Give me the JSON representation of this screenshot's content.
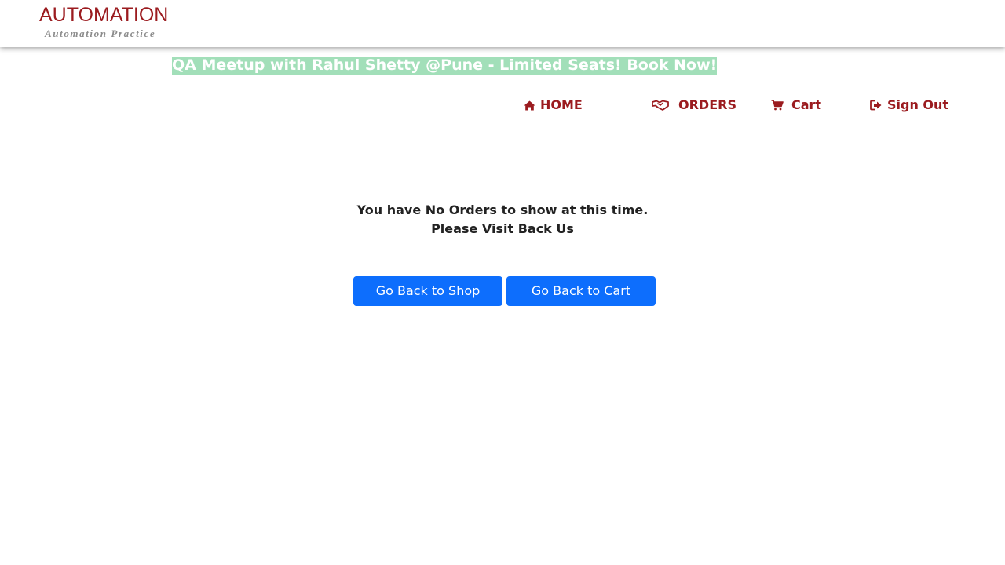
{
  "header": {
    "logo_title": "AUTOMATION",
    "logo_subtitle": "Automation Practice"
  },
  "banner": {
    "text": "QA Meetup with Rahul Shetty @Pune - Limited Seats! Book Now!"
  },
  "nav": {
    "items": [
      {
        "label": "HOME",
        "icon": "home-icon"
      },
      {
        "label": "ORDERS",
        "icon": "handshake-icon"
      },
      {
        "label": "Cart",
        "icon": "shopping-cart-icon"
      },
      {
        "label": "Sign Out",
        "icon": "sign-out-icon"
      }
    ]
  },
  "main": {
    "message_line1": "You have No Orders to show at this time.",
    "message_line2": "Please Visit Back Us",
    "shop_button_label": "Go Back to Shop",
    "cart_button_label": "Go Back to Cart"
  },
  "colors": {
    "brand": "#9b1b1f",
    "banner_bg": "#a2dfb9",
    "button_bg": "#0d6efd"
  }
}
